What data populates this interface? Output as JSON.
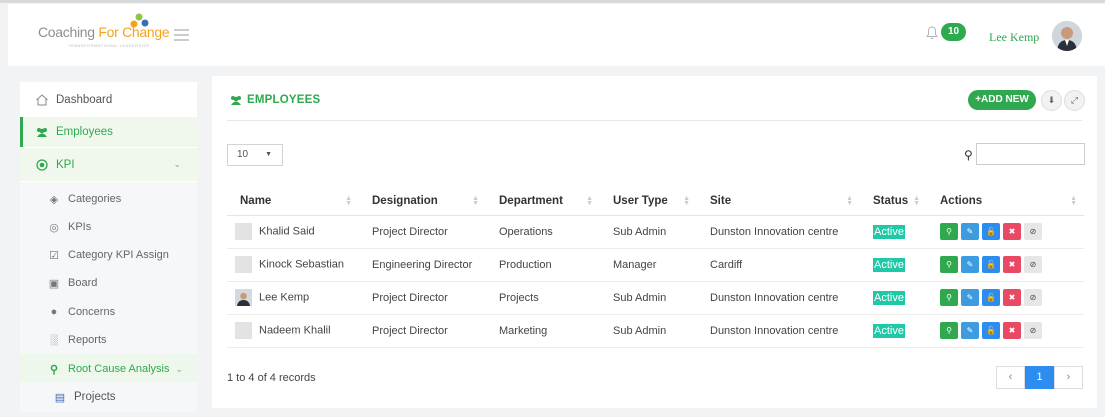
{
  "header": {
    "logo_part1": "Coaching",
    "logo_part2": "For",
    "logo_part3": "Change",
    "logo_sub": "TRANSFORMATIONAL LEADERSHIP",
    "notification_count": "10",
    "user_name": "Lee Kemp"
  },
  "sidebar": {
    "items": [
      {
        "label": "Dashboard",
        "icon": "home-icon"
      },
      {
        "label": "Employees",
        "icon": "users-icon"
      },
      {
        "label": "KPI",
        "icon": "target-icon"
      },
      {
        "label": "Categories",
        "icon": "tags-icon"
      },
      {
        "label": "KPIs",
        "icon": "target-icon"
      },
      {
        "label": "Category KPI Assign",
        "icon": "check-square-icon"
      },
      {
        "label": "Board",
        "icon": "board-icon"
      },
      {
        "label": "Concerns",
        "icon": "comment-icon"
      },
      {
        "label": "Reports",
        "icon": "bar-chart-icon"
      },
      {
        "label": "Root Cause Analysis",
        "icon": "search-icon"
      },
      {
        "label": "Projects",
        "icon": "folder-icon"
      }
    ]
  },
  "main": {
    "title": "EMPLOYEES",
    "add_label": "+ADD NEW",
    "page_length": "10",
    "search_value": "",
    "columns": [
      "Name",
      "Designation",
      "Department",
      "User Type",
      "Site",
      "Status",
      "Actions"
    ],
    "rows": [
      {
        "name": "Khalid Said",
        "designation": "Project Director",
        "department": "Operations",
        "user_type": "Sub Admin",
        "site": "Dunston Innovation centre",
        "status": "Active"
      },
      {
        "name": "Kinock Sebastian",
        "designation": "Engineering Director",
        "department": "Production",
        "user_type": "Manager",
        "site": "Cardiff",
        "status": "Active"
      },
      {
        "name": "Lee Kemp",
        "designation": "Project Director",
        "department": "Projects",
        "user_type": "Sub Admin",
        "site": "Dunston Innovation centre",
        "status": "Active"
      },
      {
        "name": "Nadeem Khalil",
        "designation": "Project Director",
        "department": "Marketing",
        "user_type": "Sub Admin",
        "site": "Dunston Innovation centre",
        "status": "Active"
      }
    ],
    "info": "1 to 4 of 4 records",
    "pager": {
      "prev": "‹",
      "current": "1",
      "next": "›"
    }
  },
  "colors": {
    "accent": "#2fa84f",
    "status": "#1fc9a8",
    "edit": "#3d9be0",
    "delete": "#e94a63"
  }
}
